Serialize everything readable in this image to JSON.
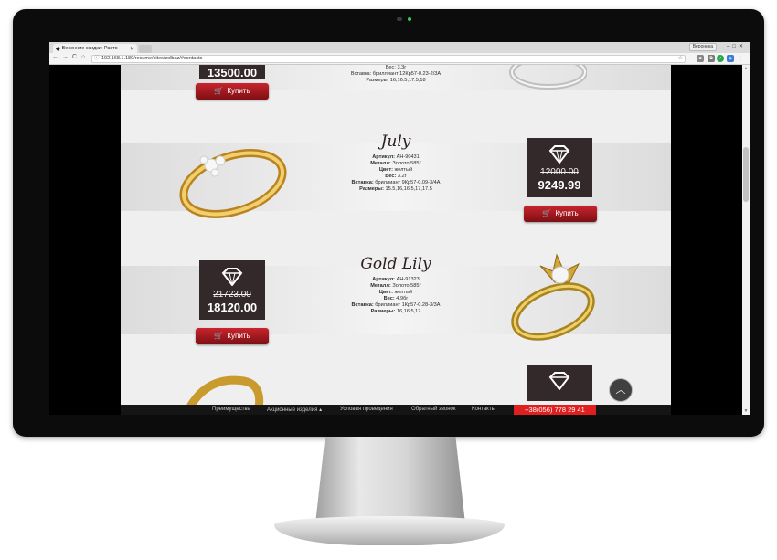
{
  "browser": {
    "tab_title": "Весенние скидки: Расто",
    "tab_close": "✕",
    "profile_label": "Вероника",
    "url": "192.168.1.180/resume/sites/zolbaz/#contacts"
  },
  "nav": {
    "back": "←",
    "forward": "→",
    "reload": "C",
    "home": "⌂"
  },
  "buy_label": "Купить",
  "products": [
    {
      "new_price": "13500.00",
      "specs": [
        {
          "label": "",
          "value": "Вес: 3.3г"
        },
        {
          "label": "",
          "value": "Вставка: бриллиант 12Кр57-0.23-2/3А"
        },
        {
          "label": "",
          "value": "Размеры: 16,16.5,17.5,18"
        }
      ]
    },
    {
      "name": "July",
      "old_price": "12000.00",
      "new_price": "9249.99",
      "specs": [
        {
          "label": "Артикул:",
          "value": "АН-90431"
        },
        {
          "label": "Металл:",
          "value": "Золото 585°"
        },
        {
          "label": "Цвет:",
          "value": "желтый"
        },
        {
          "label": "Вес:",
          "value": "3.2г"
        },
        {
          "label": "Вставка:",
          "value": "бриллиант 9Кр57-0.09-3/4А"
        },
        {
          "label": "Размеры:",
          "value": "15.5,16,16.5,17,17.5"
        }
      ]
    },
    {
      "name": "Gold Lily",
      "old_price": "21723.00",
      "new_price": "18120.00",
      "specs": [
        {
          "label": "Артикул:",
          "value": "АН-91323"
        },
        {
          "label": "Металл:",
          "value": "Золото 585°"
        },
        {
          "label": "Цвет:",
          "value": "желтый"
        },
        {
          "label": "Вес:",
          "value": "4.9бг"
        },
        {
          "label": "Вставка:",
          "value": "бриллиант 1Кр57-0.28-3/3А"
        },
        {
          "label": "Размеры:",
          "value": "16,16.5,17"
        }
      ]
    }
  ],
  "bottom_nav": {
    "items": [
      "Преимущества",
      "Акционные изделия ▴",
      "Условия проведения",
      "Обратный звонок",
      "Контакты"
    ],
    "phone": "+38(056) 778 29 41"
  },
  "scroll_up_icon": "chevron-up",
  "colors": {
    "price_box": "#33282a",
    "buy_button": "#b01c22",
    "phone_bg": "#e02020",
    "nav_bg": "#151515"
  }
}
